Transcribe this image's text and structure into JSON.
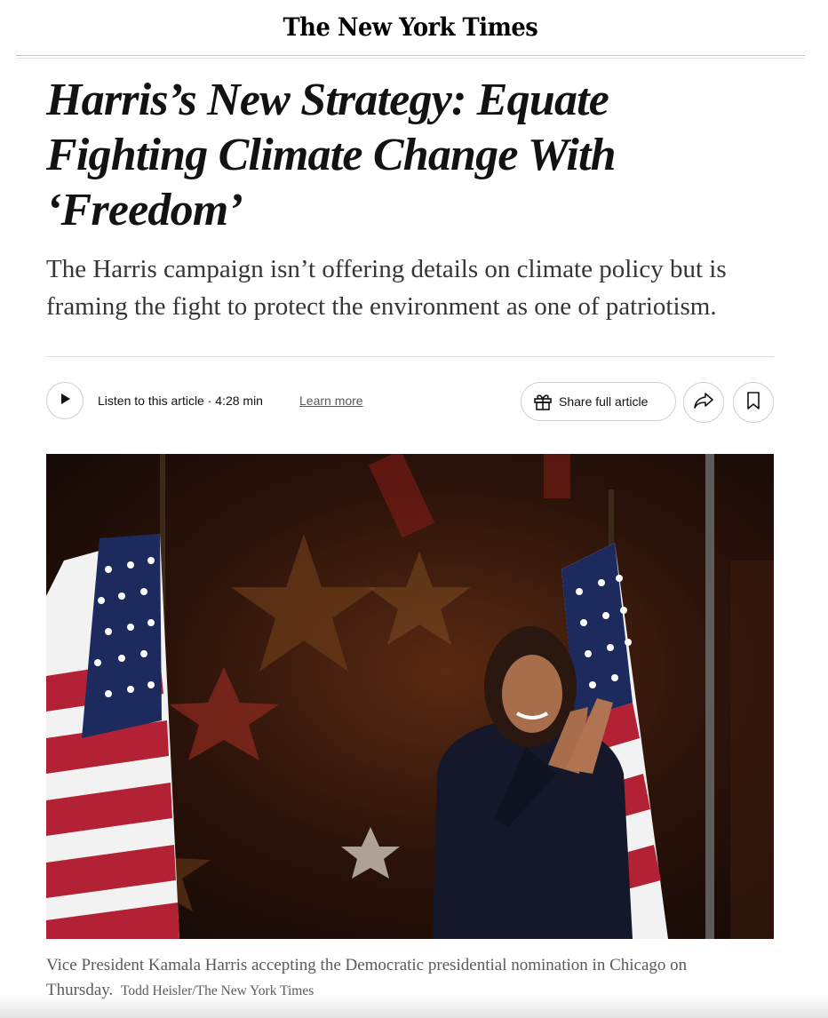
{
  "masthead": {
    "logo_text": "The New York Times"
  },
  "article": {
    "headline": "Harris’s New Strategy: Equate Fighting Climate Change With ‘Freedom’",
    "summary": "The Harris campaign isn’t offering details on climate policy but is framing the fight to protect the environment as one of patriotism."
  },
  "toolbar": {
    "play_icon": "play-icon",
    "listen_label": "Listen to this article · 4:28 min",
    "learn_more": "Learn more",
    "share_label": "Share full article",
    "gift_icon": "gift-icon",
    "forward_icon": "share-arrow-icon",
    "bookmark_icon": "bookmark-icon"
  },
  "photo": {
    "caption": "Vice President Kamala Harris accepting the Democratic presidential nomination in Chicago on Thursday.",
    "credit": "Todd Heisler/The New York Times"
  }
}
